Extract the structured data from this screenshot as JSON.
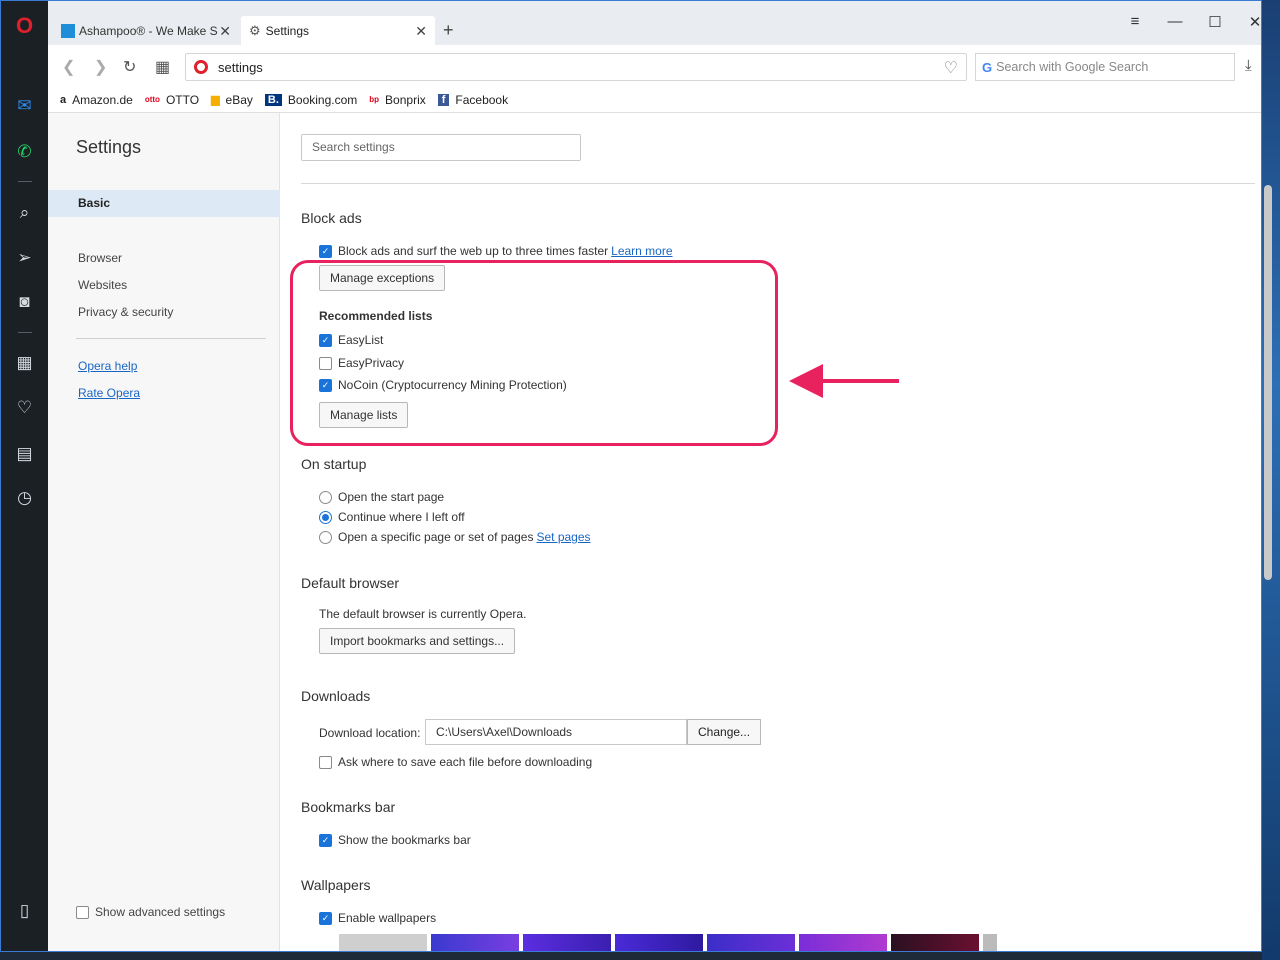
{
  "browser": {
    "tabs": [
      {
        "label": "Ashampoo® - We Make S"
      },
      {
        "label": "Settings"
      }
    ],
    "address": "settings",
    "search_placeholder": "Search with Google Search",
    "bookmarks": [
      "Amazon.de",
      "OTTO",
      "eBay",
      "Booking.com",
      "Bonprix",
      "Facebook"
    ]
  },
  "settings_nav": {
    "title": "Settings",
    "active": "Basic",
    "items": [
      "Browser",
      "Websites",
      "Privacy & security"
    ],
    "links": [
      "Opera help",
      "Rate Opera"
    ],
    "advanced": "Show advanced settings"
  },
  "main": {
    "search_placeholder": "Search settings",
    "block_ads": {
      "heading": "Block ads",
      "checkbox": "Block ads and surf the web up to three times faster",
      "learn_more": "Learn more",
      "manage_exceptions": "Manage exceptions",
      "recommended_heading": "Recommended lists",
      "lists": [
        {
          "label": "EasyList",
          "checked": true
        },
        {
          "label": "EasyPrivacy",
          "checked": false
        },
        {
          "label": "NoCoin (Cryptocurrency Mining Protection)",
          "checked": true
        }
      ],
      "manage_lists": "Manage lists"
    },
    "startup": {
      "heading": "On startup",
      "options": [
        "Open the start page",
        "Continue where I left off",
        "Open a specific page or set of pages"
      ],
      "set_pages": "Set pages"
    },
    "default_browser": {
      "heading": "Default browser",
      "status": "The default browser is currently Opera.",
      "import_button": "Import bookmarks and settings..."
    },
    "downloads": {
      "heading": "Downloads",
      "location_label": "Download location:",
      "location_value": "C:\\Users\\Axel\\Downloads",
      "change_button": "Change...",
      "ask_checkbox": "Ask where to save each file before downloading"
    },
    "bookmarks_bar": {
      "heading": "Bookmarks bar",
      "checkbox": "Show the bookmarks bar"
    },
    "wallpapers": {
      "heading": "Wallpapers",
      "checkbox": "Enable wallpapers"
    }
  },
  "colors": {
    "accent": "#1a73d8",
    "highlight": "#e8225e",
    "sidebar": "#1b2025"
  }
}
